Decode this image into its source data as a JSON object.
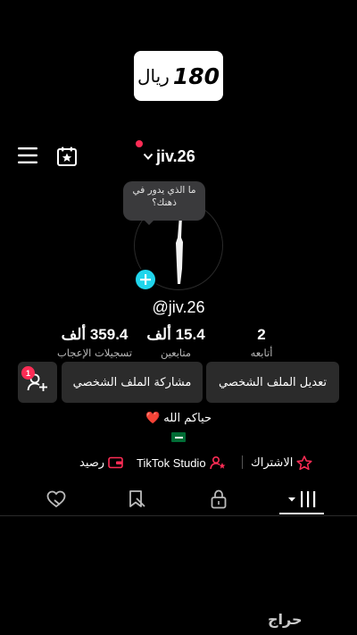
{
  "price_tag": {
    "amount": "180",
    "currency": "ريال"
  },
  "header": {
    "username": "jiv.26",
    "menu_icon": "menu-icon",
    "calendar_icon": "calendar-star-icon",
    "has_notification_dot": true
  },
  "avatar": {
    "thought_bubble": "ما الذي يدور في ذهنك؟",
    "add_icon": "plus-icon"
  },
  "profile": {
    "handle": "@jiv.26"
  },
  "stats": [
    {
      "value": "359.4 ألف",
      "label": "تسجيلات الإعجاب"
    },
    {
      "value": "15.4 ألف",
      "label": "متابعين"
    },
    {
      "value": "2",
      "label": "أتابعه"
    }
  ],
  "buttons": {
    "edit_profile": "تعديل الملف الشخصي",
    "share_profile": "مشاركة الملف الشخصي",
    "add_friends_badge": "1"
  },
  "bio": {
    "text": "حياكم الله ❤️"
  },
  "links": {
    "balance": "رصيد",
    "studio": "TikTok Studio",
    "subscription": "الاشتراك"
  },
  "tabs": [
    "liked-hidden-icon",
    "favorites-icon",
    "lock-icon",
    "videos-grid-icon"
  ],
  "watermark": "حراج",
  "colors": {
    "accent_red": "#fe2c55",
    "accent_cyan": "#20d5ec",
    "button_bg": "#2b2b2b"
  }
}
